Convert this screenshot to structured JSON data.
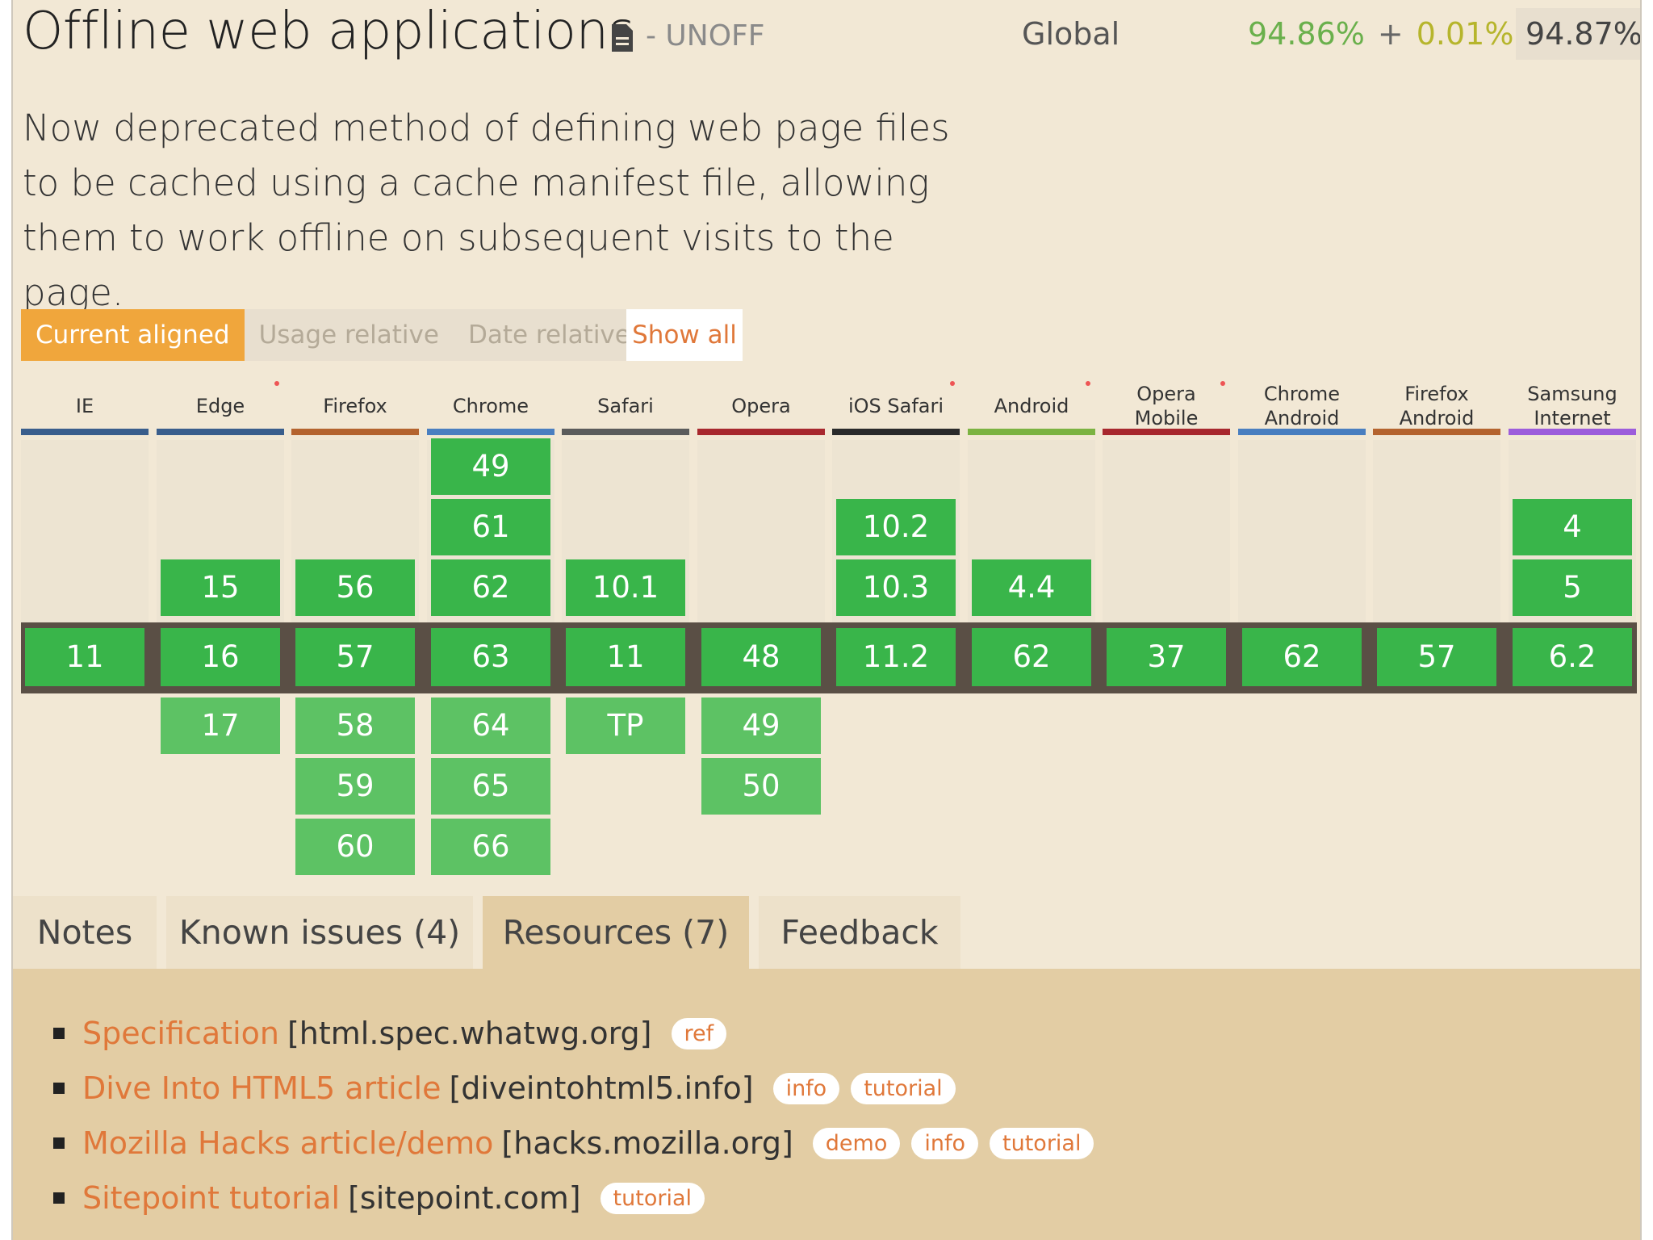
{
  "header": {
    "title": "Offline web applications",
    "status": "- UNOFF",
    "region_label": "Global",
    "usage_supported": "94.86%",
    "usage_plus": "+",
    "usage_partial": "0.01%",
    "usage_equals": "=",
    "usage_total": "94.87%"
  },
  "description": "Now deprecated method of defining web page files to be cached using a cache manifest file, allowing them to work offline on subsequent visits to the page.",
  "view_toggle": {
    "current_aligned": "Current aligned",
    "usage_relative": "Usage relative",
    "date_relative": "Date relative",
    "show_all": "Show all"
  },
  "browsers": [
    {
      "name": "IE",
      "color": "#3a5e8c",
      "note": false,
      "above": [],
      "current": "11",
      "below": []
    },
    {
      "name": "Edge",
      "color": "#3a5e8c",
      "note": true,
      "above": [
        "15"
      ],
      "current": "16",
      "below": [
        "17"
      ]
    },
    {
      "name": "Firefox",
      "color": "#b5642f",
      "note": false,
      "above": [
        "56"
      ],
      "current": "57",
      "below": [
        "58",
        "59",
        "60"
      ]
    },
    {
      "name": "Chrome",
      "color": "#4a7fc0",
      "note": false,
      "above": [
        "49",
        "61",
        "62"
      ],
      "current": "63",
      "below": [
        "64",
        "65",
        "66"
      ]
    },
    {
      "name": "Safari",
      "color": "#5c5c5c",
      "note": false,
      "above": [
        "10.1"
      ],
      "current": "11",
      "below": [
        "TP"
      ]
    },
    {
      "name": "Opera",
      "color": "#a8282e",
      "note": false,
      "above": [],
      "current": "48",
      "below": [
        "49",
        "50"
      ]
    },
    {
      "name": "iOS Safari",
      "color": "#2b2b2b",
      "note": true,
      "above": [
        "10.2",
        "10.3"
      ],
      "current": "11.2",
      "below": []
    },
    {
      "name": "Android",
      "color": "#7cb342",
      "note": true,
      "above": [
        "4.4"
      ],
      "current": "62",
      "below": []
    },
    {
      "name": "Opera Mobile",
      "color": "#a8282e",
      "note": true,
      "above": [],
      "current": "37",
      "below": []
    },
    {
      "name": "Chrome Android",
      "color": "#4a7fc0",
      "note": false,
      "above": [],
      "current": "62",
      "below": []
    },
    {
      "name": "Firefox Android",
      "color": "#b5642f",
      "note": false,
      "above": [],
      "current": "57",
      "below": []
    },
    {
      "name": "Samsung Internet",
      "color": "#9d5ddb",
      "note": false,
      "above": [
        "4",
        "5"
      ],
      "current": "6.2",
      "below": []
    }
  ],
  "tabs": [
    {
      "label": "Notes",
      "active": false
    },
    {
      "label": "Known issues (4)",
      "active": false
    },
    {
      "label": "Resources (7)",
      "active": true
    },
    {
      "label": "Feedback",
      "active": false
    }
  ],
  "resources": [
    {
      "link": "Specification",
      "domain": "[html.spec.whatwg.org]",
      "tags": [
        "ref"
      ]
    },
    {
      "link": "Dive Into HTML5 article",
      "domain": "[diveintohtml5.info]",
      "tags": [
        "info",
        "tutorial"
      ]
    },
    {
      "link": "Mozilla Hacks article/demo",
      "domain": "[hacks.mozilla.org]",
      "tags": [
        "demo",
        "info",
        "tutorial"
      ]
    },
    {
      "link": "Sitepoint tutorial",
      "domain": "[sitepoint.com]",
      "tags": [
        "tutorial"
      ]
    }
  ],
  "colors": {
    "supported": "#39b54a",
    "accent": "#f0a63c",
    "link": "#e0783a"
  }
}
